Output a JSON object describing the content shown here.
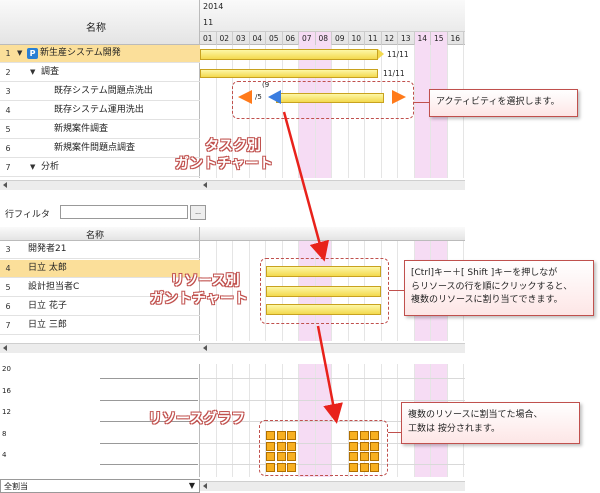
{
  "task_panel": {
    "header_name": "名称",
    "year": "2014",
    "month": "11",
    "days": [
      "01",
      "02",
      "03",
      "04",
      "05",
      "06",
      "07",
      "08",
      "09",
      "10",
      "11",
      "12",
      "13",
      "14",
      "15",
      "16"
    ],
    "rows": [
      {
        "num": "1",
        "label": "新生産システム開発",
        "bar_label": "11/11",
        "selected": true,
        "level": 0
      },
      {
        "num": "2",
        "label": "調査",
        "bar_label": "11/11",
        "level": 1
      },
      {
        "num": "3",
        "label": "既存システム問題点洗出",
        "bar_start": "/5",
        "bar_top": "(9",
        "level": 2
      },
      {
        "num": "4",
        "label": "既存システム運用洗出",
        "level": 2
      },
      {
        "num": "5",
        "label": "新規案件調査",
        "level": 2
      },
      {
        "num": "6",
        "label": "新規案件問題点調査",
        "level": 2
      },
      {
        "num": "7",
        "label": "分析",
        "level": 1
      }
    ],
    "project_icon": "P",
    "callout_label_line1": "タスク別",
    "callout_label_line2": "ガントチャート",
    "note": "アクティビティを選択します。"
  },
  "filter": {
    "label": "行フィルタ",
    "value": "",
    "button": "..."
  },
  "resource_panel": {
    "header_name": "名称",
    "rows": [
      {
        "num": "3",
        "label": "開発者21"
      },
      {
        "num": "4",
        "label": "日立 太郎",
        "selected": true
      },
      {
        "num": "5",
        "label": "設計担当者C"
      },
      {
        "num": "6",
        "label": "日立 花子"
      },
      {
        "num": "7",
        "label": "日立 三郎"
      }
    ],
    "callout_label_line1": "リソース別",
    "callout_label_line2": "ガントチャート",
    "note_line1": "[Ctrl]キー＋[ Shift ]キーを押しなが",
    "note_line2": "らリソースの行を順にクリックすると、",
    "note_line3": "複数のリソースに割り当てできます。"
  },
  "graph_panel": {
    "y_ticks": [
      "20",
      "16",
      "12",
      "8",
      "4"
    ],
    "select_value": "全割当",
    "callout_label": "リソースグラフ",
    "note_line1": "複数のリソースに割当てた場合、",
    "note_line2": "工数は 按分されます。"
  },
  "colors": {
    "accent": "#c0504d",
    "selected_row": "#fbdf9a",
    "weekend": "#f6dcf4",
    "bar_fill": "#f6e26a",
    "arrow_left": "#ff7a1a",
    "arrow_blue": "#3a7de0"
  }
}
